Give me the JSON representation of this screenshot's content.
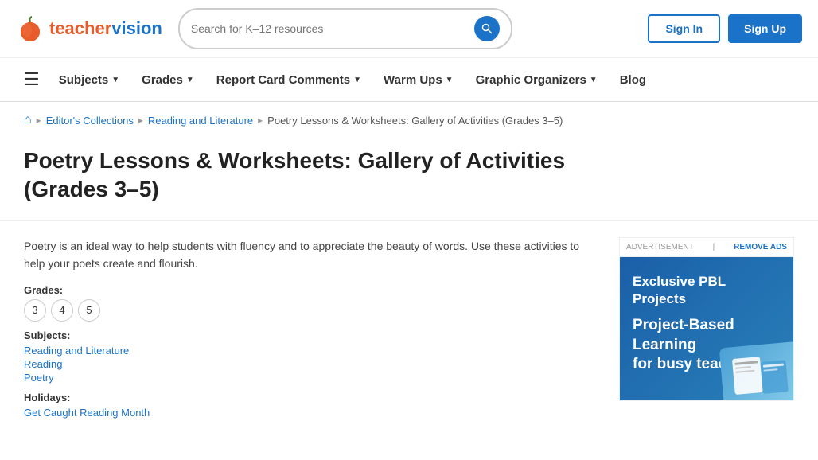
{
  "header": {
    "logo_text_teacher": "teacher",
    "logo_text_vision": "vision",
    "search_placeholder": "Search for K–12 resources",
    "signin_label": "Sign In",
    "signup_label": "Sign Up"
  },
  "nav": {
    "subjects_label": "Subjects",
    "grades_label": "Grades",
    "report_card_label": "Report Card Comments",
    "warm_ups_label": "Warm Ups",
    "graphic_organizers_label": "Graphic Organizers",
    "blog_label": "Blog"
  },
  "breadcrumb": {
    "home_title": "Home",
    "editors_collections": "Editor's Collections",
    "reading_literature": "Reading and Literature",
    "current": "Poetry Lessons & Worksheets: Gallery of Activities (Grades 3–5)"
  },
  "page": {
    "title": "Poetry Lessons & Worksheets: Gallery of Activities (Grades 3–5)",
    "description": "Poetry is an ideal way to help students with fluency and to appreciate the beauty of words. Use these activities to help your poets create and flourish.",
    "grades_label": "Grades:",
    "grades": [
      "3",
      "4",
      "5"
    ],
    "subjects_label": "Subjects:",
    "subjects": [
      "Reading and Literature",
      "Reading",
      "Poetry"
    ],
    "holidays_label": "Holidays:",
    "holidays": [
      "Get Caught Reading Month"
    ]
  },
  "sidebar": {
    "advertisement_label": "ADVERTISEMENT",
    "remove_ads_label": "REMOVE ADS",
    "ad_title": "Exclusive PBL Projects",
    "ad_subtitle_line1": "Project-Based",
    "ad_subtitle_line2": "Learning",
    "ad_subtitle_line3": "for busy teachers!"
  }
}
